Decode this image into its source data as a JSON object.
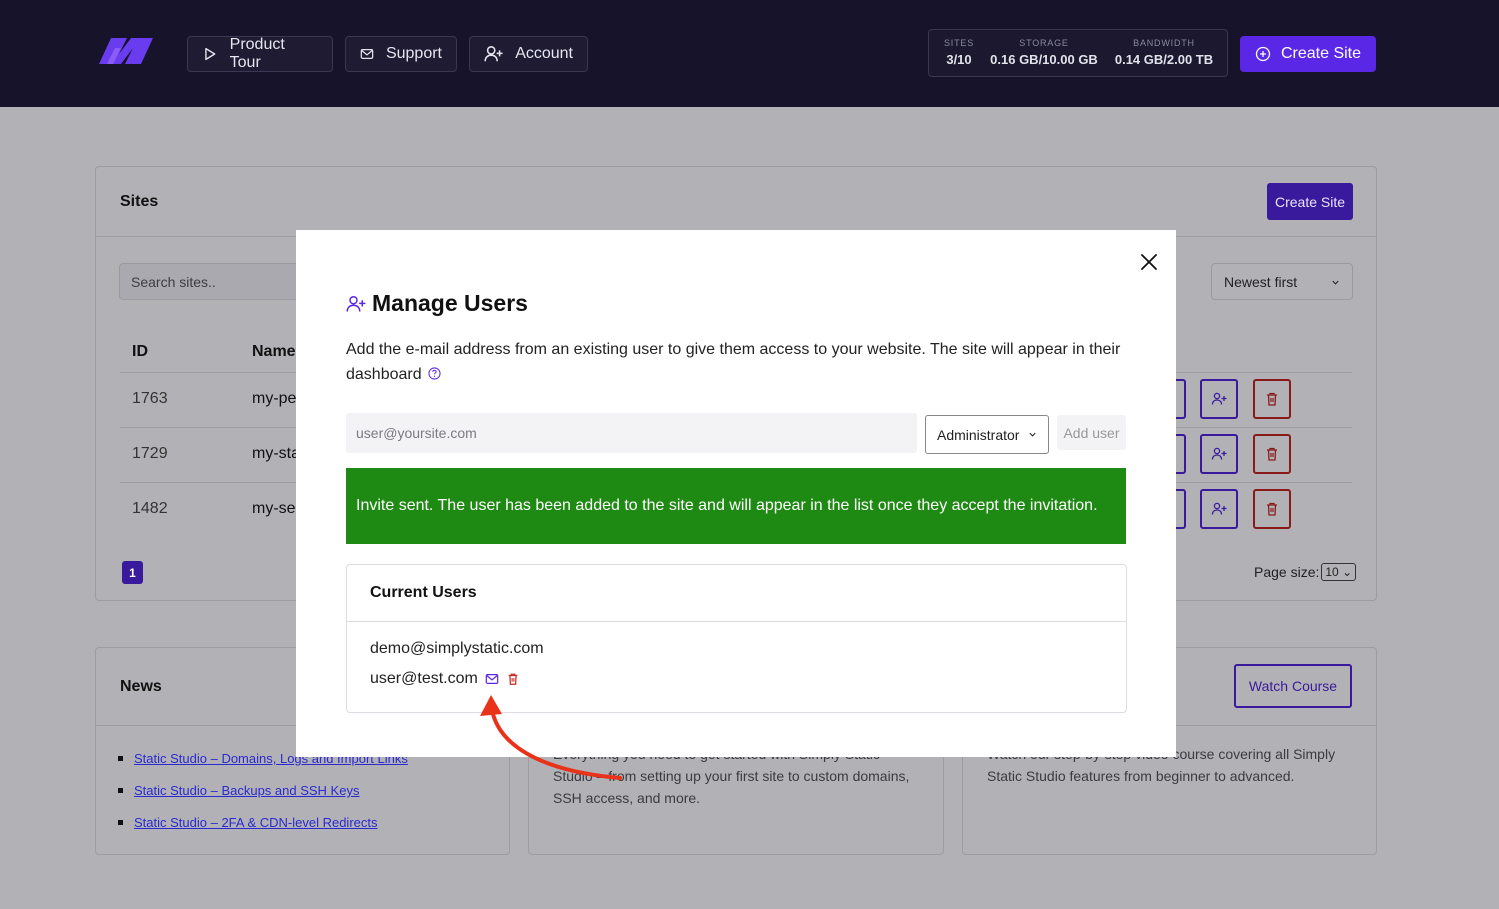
{
  "header": {
    "nav": [
      {
        "label": "Product Tour",
        "icon": "play-icon"
      },
      {
        "label": "Support",
        "icon": "mail-icon"
      },
      {
        "label": "Account",
        "icon": "user-plus-icon"
      }
    ],
    "stats": [
      {
        "label": "SITES",
        "value": "3/10"
      },
      {
        "label": "STORAGE",
        "value": "0.16 GB/10.00 GB"
      },
      {
        "label": "BANDWIDTH",
        "value": "0.14 GB/2.00 TB"
      }
    ],
    "create_site": "Create Site"
  },
  "sites": {
    "title": "Sites",
    "create_label": "Create Site",
    "search_placeholder": "Search sites..",
    "sort": "Newest first",
    "columns": [
      "ID",
      "Name"
    ],
    "rows": [
      {
        "id": "1763",
        "name": "my-pe"
      },
      {
        "id": "1729",
        "name": "my-sta"
      },
      {
        "id": "1482",
        "name": "my-se"
      }
    ],
    "page": "1",
    "page_size_label": "Page size:",
    "page_size": "10"
  },
  "news": {
    "title": "News",
    "links": [
      "Static Studio – Domains, Logs and Import Links",
      "Static Studio – Backups and SSH Keys",
      "Static Studio – 2FA & CDN-level Redirects"
    ]
  },
  "guide": {
    "text": "Everything you need to get started with Simply Static Studio – from setting up your first site to custom domains, SSH access, and more."
  },
  "course": {
    "text": "Watch our step-by-step video course covering all Simply Static Studio features from beginner to advanced.",
    "button": "Watch Course"
  },
  "modal": {
    "title": "Manage Users",
    "description": "Add the e-mail address from an existing user to give them access to your website. The site will appear in their dashboard",
    "email_placeholder": "user@yoursite.com",
    "role": "Administrator",
    "add_user": "Add user",
    "alert": "Invite sent. The user has been added to the site and will appear in the list once they accept the invitation.",
    "current_users_title": "Current Users",
    "users": [
      {
        "email": "demo@simplystatic.com"
      },
      {
        "email": "user@test.com"
      }
    ]
  },
  "colors": {
    "accent": "#5b27e6",
    "success": "#1f8a13",
    "danger": "#c62828",
    "arrow": "#e8321a"
  }
}
